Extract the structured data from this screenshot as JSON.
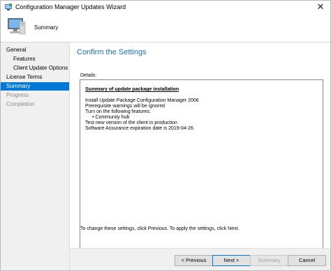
{
  "window": {
    "title": "Configuration Manager Updates Wizard",
    "close_glyph": "✕"
  },
  "header": {
    "title": "Summary"
  },
  "sidebar": {
    "items": [
      {
        "label": "General"
      },
      {
        "label": "Features"
      },
      {
        "label": "Client Update Options"
      },
      {
        "label": "License Terms"
      },
      {
        "label": "Summary"
      },
      {
        "label": "Progress"
      },
      {
        "label": "Completion"
      }
    ]
  },
  "main": {
    "heading": "Confirm the Settings",
    "details_label": "Details:",
    "summary_heading": "Summary of update package installation",
    "lines": [
      "Install Update Package Configuration Manager 2006",
      "Prerequisite warnings will be ignored",
      "Turn on the following features:"
    ],
    "bullet": "• Community hub",
    "lines_after": [
      "Test new version of the client in production",
      "Software Assurance expiration date is 2019-04-26"
    ],
    "hint": "To change these settings, click Previous. To apply the settings, click Next."
  },
  "buttons": {
    "previous": "< Previous",
    "next": "Next >",
    "summary": "Summary",
    "cancel": "Cancel"
  },
  "colors": {
    "accent": "#0078d7",
    "heading": "#1e6fb5"
  },
  "icons": {
    "app": "wizard-app-icon",
    "header": "computer-icon",
    "close": "close-icon"
  }
}
